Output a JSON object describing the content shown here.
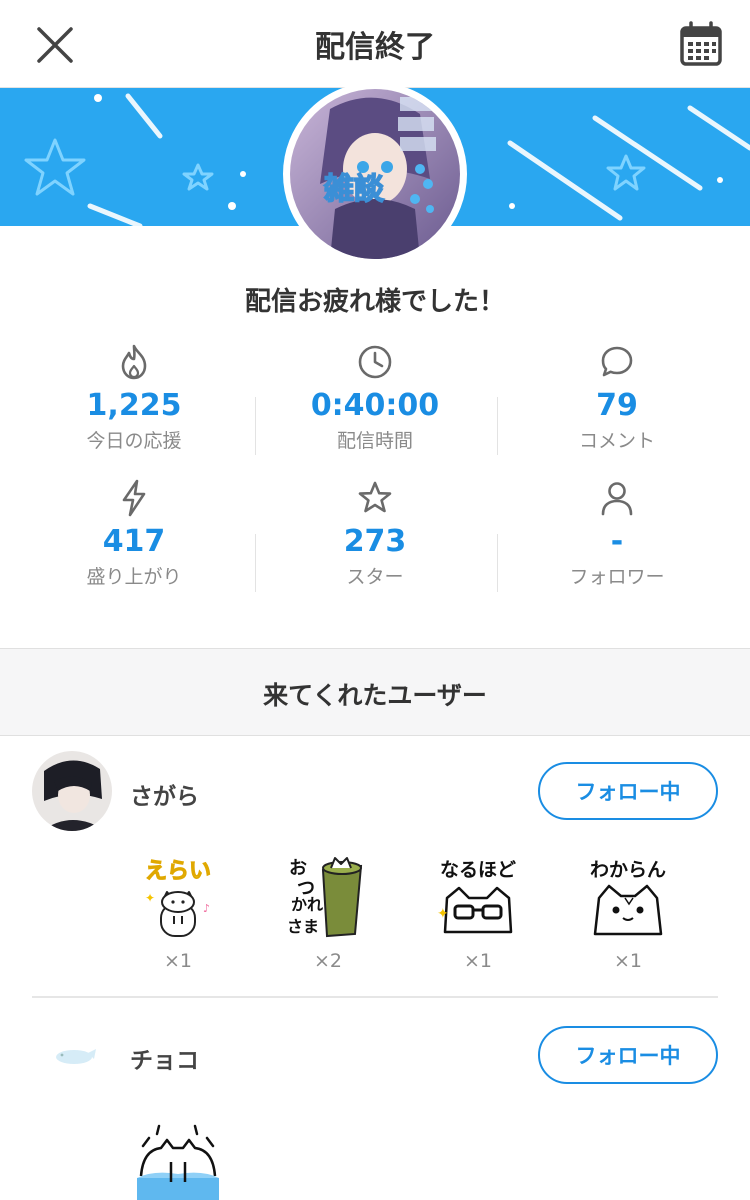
{
  "header": {
    "title": "配信終了",
    "close_icon": "close-icon",
    "calendar_icon": "calendar-icon"
  },
  "banner": {
    "color": "#2aa7f0",
    "avatar_caption": "雑談"
  },
  "thanks_message": "配信お疲れ様でした！",
  "stats": [
    {
      "icon": "flame-icon",
      "value": "1,225",
      "label": "今日の応援"
    },
    {
      "icon": "clock-icon",
      "value": "0:40:00",
      "label": "配信時間"
    },
    {
      "icon": "comment-icon",
      "value": "79",
      "label": "コメント"
    },
    {
      "icon": "lightning-icon",
      "value": "417",
      "label": "盛り上がり"
    },
    {
      "icon": "star-icon",
      "value": "273",
      "label": "スター"
    },
    {
      "icon": "person-icon",
      "value": "-",
      "label": "フォロワー"
    }
  ],
  "section": {
    "title": "来てくれたユーザー"
  },
  "users": [
    {
      "name": "さがら",
      "follow_label": "フォロー中",
      "stamps": [
        {
          "icon": "erai-stamp",
          "text": "えらい",
          "count": "×1"
        },
        {
          "icon": "otsukaresama-stamp",
          "text": "おつかれさま",
          "count": "×2"
        },
        {
          "icon": "naruhodo-stamp",
          "text": "なるほど",
          "count": "×1"
        },
        {
          "icon": "wakaran-stamp",
          "text": "わからん",
          "count": "×1"
        }
      ]
    },
    {
      "name": "チョコ",
      "follow_label": "フォロー中",
      "stamps": [
        {
          "icon": "crying-cat-stamp"
        }
      ]
    }
  ],
  "accent_color": "#1a8de3"
}
